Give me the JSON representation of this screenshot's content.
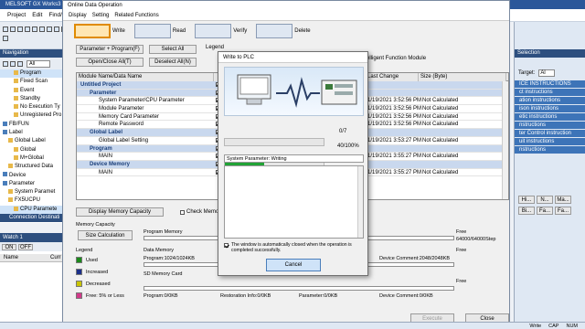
{
  "app": {
    "title": "MELSOFT GX Works3"
  },
  "menu": {
    "items": [
      "Project",
      "Edit",
      "Find/R",
      "Display",
      "Setting",
      "Related Functions"
    ]
  },
  "nav": {
    "header": "Navigation",
    "filter": "All",
    "rows": [
      {
        "label": "Program",
        "indent": 2,
        "sel": true
      },
      {
        "label": "Fixed Scan",
        "indent": 2
      },
      {
        "label": "Event",
        "indent": 2
      },
      {
        "label": "Standby",
        "indent": 2
      },
      {
        "label": "No Execution Ty",
        "indent": 2
      },
      {
        "label": "Unregistered Pro",
        "indent": 2
      },
      {
        "label": "FB/FUN",
        "indent": 0
      },
      {
        "label": "Label",
        "indent": 0
      },
      {
        "label": "Global Label",
        "indent": 1
      },
      {
        "label": "Global",
        "indent": 2
      },
      {
        "label": "M+Global",
        "indent": 2
      },
      {
        "label": "Structured Data",
        "indent": 1
      },
      {
        "label": "Device",
        "indent": 0
      },
      {
        "label": "Parameter",
        "indent": 0
      },
      {
        "label": "System Paramet",
        "indent": 1
      },
      {
        "label": "FX5UCPU",
        "indent": 1
      },
      {
        "label": "CPU Paramete",
        "indent": 2,
        "sel": true
      },
      {
        "label": "Connection Destinati",
        "indent": 0,
        "head": true
      }
    ]
  },
  "watch": {
    "title": "Watch 1",
    "btns": [
      "ON",
      "OFF"
    ],
    "cols": [
      "Name",
      "Curr"
    ]
  },
  "dialog": {
    "title": "Online Data Operation",
    "menu": [
      "Display",
      "Setting",
      "Related Functions"
    ],
    "wizard": [
      "Write",
      "Read",
      "Verify",
      "Delete"
    ],
    "buttons": {
      "param_program": "Parameter + Program(F)",
      "select_all": "Select All",
      "open_close_all": "Open/Close All(T)",
      "deselect_all": "Deselect All(N)",
      "legend": "Legend",
      "intelligent": "elligent Function Module",
      "display_memory_capacity": "Display Memory Capacity",
      "check_memory": "Check Memory Ca",
      "size_calc": "Size Calculation",
      "execute": "Execute",
      "close": "Close"
    },
    "table": {
      "cols": [
        "Module Name/Data Name",
        "",
        "Last Change",
        "Size (Byte)"
      ],
      "rows": [
        {
          "name": "Untitled Project",
          "cat": true,
          "indent": 0
        },
        {
          "name": "Parameter",
          "cat": true,
          "indent": 1
        },
        {
          "name": "System Parameter/CPU Parameter",
          "indent": 2,
          "date": "1/19/2021 3:52:56 PM",
          "size": "Not Calculated"
        },
        {
          "name": "Module Parameter",
          "indent": 2,
          "date": "1/19/2021 3:52:56 PM",
          "size": "Not Calculated"
        },
        {
          "name": "Memory Card Parameter",
          "indent": 2,
          "date": "1/19/2021 3:52:56 PM",
          "size": "Not Calculated"
        },
        {
          "name": "Remote Password",
          "indent": 2,
          "date": "1/19/2021 3:52:56 PM",
          "size": "Not Calculated"
        },
        {
          "name": "Global Label",
          "cat": true,
          "indent": 1
        },
        {
          "name": "Global Label Setting",
          "indent": 2,
          "date": "1/19/2021 3:53:27 PM",
          "size": "Not Calculated"
        },
        {
          "name": "Program",
          "cat": true,
          "indent": 1
        },
        {
          "name": "MAIN",
          "indent": 2,
          "date": "1/19/2021 3:55:27 PM",
          "size": "Not Calculated"
        },
        {
          "name": "Device Memory",
          "cat": true,
          "indent": 1
        },
        {
          "name": "MAIN",
          "indent": 2,
          "date": "1/19/2021 3:55:27 PM",
          "size": "Not Calculated"
        }
      ]
    },
    "memory": {
      "title": "Memory Capacity",
      "legend_title": "Legend",
      "legend": [
        {
          "label": "Used",
          "color": "#1a8a1a"
        },
        {
          "label": "Increased",
          "color": "#1b2f8a"
        },
        {
          "label": "Decreased",
          "color": "#c9c400"
        },
        {
          "label": "Free: 5% or Less",
          "color": "#d23a8a"
        }
      ],
      "program_memory": "Program Memory",
      "program_free": "Free",
      "program_free_val": "64000/64000Step",
      "data_memory": "Data Memory",
      "data_memory_val": "Program:1024/1024KB",
      "device_comment": "Device Comment:2048/2048KB",
      "data_free": "Free",
      "sd_card": "SD Memory Card",
      "sd_program": "Program:0/0KB",
      "sd_restoration": "Restoration Info:0/0KB",
      "sd_parameter": "Parameter:0/0KB",
      "sd_device_comment": "Device Comment:0/0KB",
      "sd_free": "Free"
    }
  },
  "modal": {
    "title": "Write to PLC",
    "progress1": {
      "label": "0/7",
      "fraction": 0
    },
    "progress2": {
      "label": "40/100%",
      "fraction": 0.4
    },
    "status": "System Parameter: Writing",
    "auto_close": "The window is automatically closed when the operation is completed successfully.",
    "cancel": "Cancel"
  },
  "right": {
    "header": "Selection",
    "target_label": "Target:",
    "target_value": "Al",
    "items": [
      "ICE INSTRUCTIONS",
      "ct instructions",
      "ation instructions",
      "ison instructions",
      "etic instructions",
      "nstructions",
      "ter Control instruction",
      "uit instructions",
      "nstructions"
    ],
    "tabs": [
      "Hi...",
      "N...",
      "Ma..."
    ],
    "tabs2": [
      "Bi...",
      "Fa...",
      "Fa..."
    ]
  },
  "status": {
    "items": [
      "CAP",
      "NUM",
      "Write"
    ]
  },
  "colors": {
    "nav_header": "#2d4f7f",
    "category": "#c9d8ee",
    "progress": "#21a336",
    "wizard_active": "#e08b00"
  }
}
